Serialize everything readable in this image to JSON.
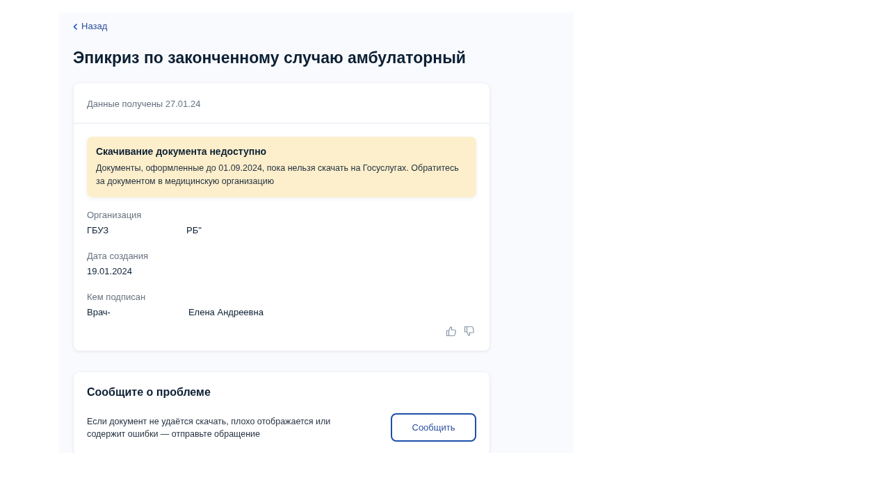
{
  "back_link": {
    "label": "Назад"
  },
  "title": "Эпикриз по законченному случаю амбулаторный",
  "document_card": {
    "received": "Данные получены 27.01.24",
    "notice": {
      "title": "Скачивание документа недоступно",
      "text": "Документы, оформленные до 01.09.2024, пока нельзя скачать на Госуслугах. Обратитесь за документом в медицинскую организацию"
    },
    "fields": [
      {
        "label": "Организация",
        "value_parts": [
          "ГБУЗ",
          "РБ\""
        ]
      },
      {
        "label": "Дата создания",
        "value_parts": [
          "19.01.2024"
        ]
      },
      {
        "label": "Кем подписан",
        "value_parts": [
          "Врач-",
          "Елена Андреевна"
        ]
      }
    ]
  },
  "problem_card": {
    "title": "Сообщите о проблеме",
    "text": "Если документ не удаётся скачать, плохо отображается или содержит ошибки — отправьте обращение",
    "button": "Сообщить"
  }
}
